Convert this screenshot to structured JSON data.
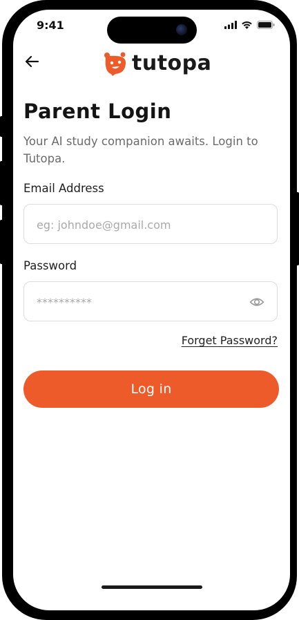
{
  "status_bar": {
    "time": "9:41"
  },
  "header": {
    "brand": "tutopa"
  },
  "page": {
    "title": "Parent Login",
    "subtitle": "Your AI study companion awaits. Login to Tutopa."
  },
  "form": {
    "email_label": "Email Address",
    "email_placeholder": "eg: johndoe@gmail.com",
    "password_label": "Password",
    "password_placeholder": "**********",
    "forgot_label": "Forget Password?",
    "login_label": "Log in"
  },
  "colors": {
    "accent": "#EE5B2A",
    "text": "#141414",
    "muted": "#6b6b6b",
    "border": "#dddddd"
  }
}
